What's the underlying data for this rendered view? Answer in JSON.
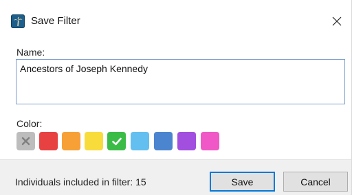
{
  "window": {
    "title": "Save Filter",
    "app_icon": "palm-tree-icon",
    "close_icon": "close-icon"
  },
  "form": {
    "name_label": "Name:",
    "name_value": "Ancestors of Joseph Kennedy",
    "color_label": "Color:",
    "colors": [
      {
        "name": "none",
        "hex": "#bdbdbd",
        "icon": "x-icon"
      },
      {
        "name": "red",
        "hex": "#e84142"
      },
      {
        "name": "orange",
        "hex": "#f7a035"
      },
      {
        "name": "yellow",
        "hex": "#f8dc3c"
      },
      {
        "name": "green",
        "hex": "#3bbc47",
        "selected": true,
        "icon": "check-icon"
      },
      {
        "name": "light-blue",
        "hex": "#62bff0"
      },
      {
        "name": "blue",
        "hex": "#4c85cf"
      },
      {
        "name": "purple",
        "hex": "#a24fe0"
      },
      {
        "name": "pink",
        "hex": "#ef58c6"
      }
    ]
  },
  "footer": {
    "status": "Individuals included in filter: 15",
    "save_label": "Save",
    "cancel_label": "Cancel"
  }
}
